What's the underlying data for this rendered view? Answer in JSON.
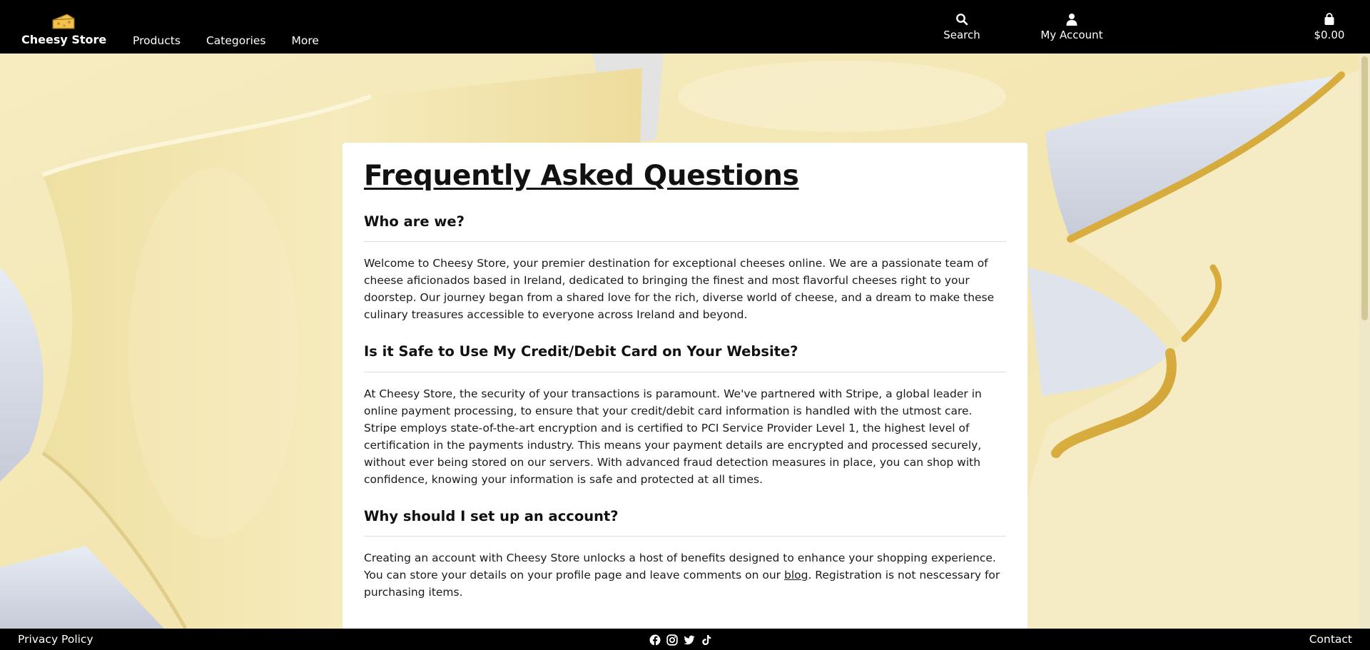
{
  "header": {
    "brand": "Cheesy Store",
    "logo_icon": "cheese-icon",
    "nav": [
      "Products",
      "Categories",
      "More"
    ],
    "utilities": {
      "search": {
        "label": "Search",
        "icon": "search-icon"
      },
      "account": {
        "label": "My Account",
        "icon": "user-icon"
      },
      "cart": {
        "label": "$0.00",
        "icon": "shopping-bag-icon"
      }
    }
  },
  "page": {
    "title": "Frequently Asked Questions",
    "faqs": [
      {
        "question": "Who are we?",
        "answer": "Welcome to Cheesy Store, your premier destination for exceptional cheeses online. We are a passionate team of cheese aficionados based in Ireland, dedicated to bringing the finest and most flavorful cheeses right to your doorstep. Our journey began from a shared love for the rich, diverse world of cheese, and a dream to make these culinary treasures accessible to everyone across Ireland and beyond."
      },
      {
        "question": "Is it Safe to Use My Credit/Debit Card on Your Website?",
        "answer": "At Cheesy Store, the security of your transactions is paramount. We've partnered with Stripe, a global leader in online payment processing, to ensure that your credit/debit card information is handled with the utmost care. Stripe employs state-of-the-art encryption and is certified to PCI Service Provider Level 1, the highest level of certification in the payments industry. This means your payment details are encrypted and processed securely, without ever being stored on our servers. With advanced fraud detection measures in place, you can shop with confidence, knowing your information is safe and protected at all times."
      },
      {
        "question": "Why should I set up an account?",
        "answer_before": "Creating an account with Cheesy Store unlocks a host of benefits designed to enhance your shopping experience. You can store your details on your profile page and leave comments on our ",
        "answer_link": "blog",
        "answer_after": ". Registration is not nescessary for purchasing items."
      }
    ]
  },
  "footer": {
    "privacy": "Privacy Policy",
    "contact": "Contact",
    "socials": [
      "facebook-icon",
      "instagram-icon",
      "twitter-icon",
      "tiktok-icon"
    ]
  },
  "colors": {
    "bar": "#000000",
    "card": "#ffffff",
    "cheese": "#f3e6b0",
    "rind": "#d9ae40"
  }
}
